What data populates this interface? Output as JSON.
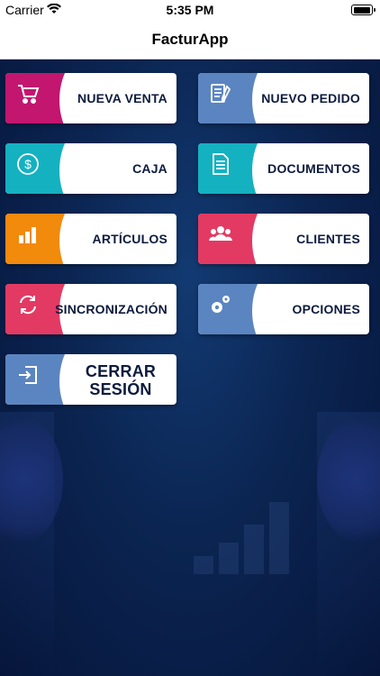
{
  "status_bar": {
    "carrier": "Carrier",
    "time": "5:35 PM"
  },
  "nav": {
    "title": "FacturApp"
  },
  "tiles": [
    {
      "label": "NUEVA VENTA",
      "color": "#c2166f",
      "icon": "cart-icon"
    },
    {
      "label": "NUEVO PEDIDO",
      "color": "#5b85c0",
      "icon": "checklist-icon"
    },
    {
      "label": "CAJA",
      "color": "#14b1c0",
      "icon": "dollar-icon"
    },
    {
      "label": "DOCUMENTOS",
      "color": "#14b1c0",
      "icon": "document-icon"
    },
    {
      "label": "ARTÍCULOS",
      "color": "#f28a0c",
      "icon": "bars-icon"
    },
    {
      "label": "CLIENTES",
      "color": "#e23a63",
      "icon": "users-icon"
    },
    {
      "label": "SINCRONIZACIÓN",
      "color": "#e23a63",
      "icon": "sync-icon"
    },
    {
      "label": "OPCIONES",
      "color": "#5b85c0",
      "icon": "gears-icon"
    },
    {
      "label": "CERRAR SESIÓN",
      "color": "#5b85c0",
      "icon": "logout-icon"
    }
  ]
}
